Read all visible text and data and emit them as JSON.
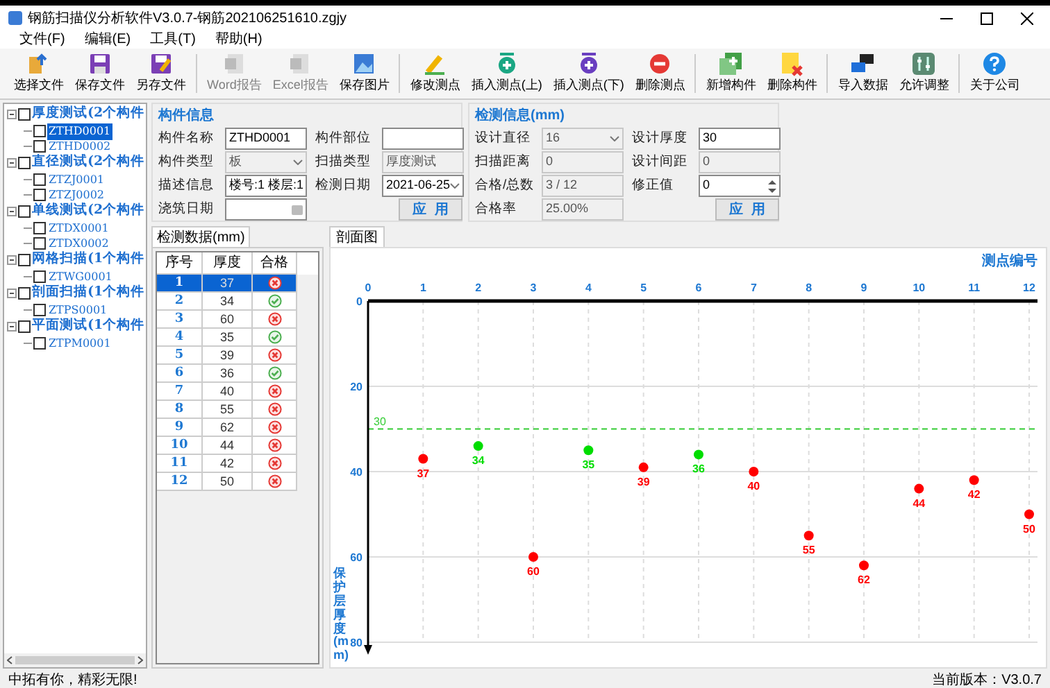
{
  "window": {
    "title": "钢筋扫描仪分析软件V3.0.7-钢筋202106251610.zgjy"
  },
  "menu": [
    "文件(F)",
    "编辑(E)",
    "工具(T)",
    "帮助(H)"
  ],
  "toolbar": [
    [
      {
        "label": "选择文件",
        "disabled": false
      },
      {
        "label": "保存文件",
        "disabled": false
      },
      {
        "label": "另存文件",
        "disabled": false
      }
    ],
    [
      {
        "label": "Word报告",
        "disabled": true
      },
      {
        "label": "Excel报告",
        "disabled": true
      },
      {
        "label": "保存图片",
        "disabled": false
      }
    ],
    [
      {
        "label": "修改测点",
        "disabled": false
      },
      {
        "label": "插入测点(上)",
        "disabled": false
      },
      {
        "label": "插入测点(下)",
        "disabled": false
      },
      {
        "label": "删除测点",
        "disabled": false
      }
    ],
    [
      {
        "label": "新增构件",
        "disabled": false
      },
      {
        "label": "删除构件",
        "disabled": false
      }
    ],
    [
      {
        "label": "导入数据",
        "disabled": false
      },
      {
        "label": "允许调整",
        "disabled": false
      }
    ],
    [
      {
        "label": "关于公司",
        "disabled": false
      }
    ]
  ],
  "tree": [
    {
      "label": "厚度测试(2个构件",
      "checked": false,
      "expanded": true,
      "children": [
        {
          "label": "ZTHD0001",
          "checked": false,
          "selected": true
        },
        {
          "label": "ZTHD0002",
          "checked": false,
          "selected": false
        }
      ]
    },
    {
      "label": "直径测试(2个构件",
      "checked": false,
      "expanded": true,
      "children": [
        {
          "label": "ZTZJ0001",
          "checked": false,
          "selected": false
        },
        {
          "label": "ZTZJ0002",
          "checked": false,
          "selected": false
        }
      ]
    },
    {
      "label": "单线测试(2个构件",
      "checked": false,
      "expanded": true,
      "children": [
        {
          "label": "ZTDX0001",
          "checked": false,
          "selected": false
        },
        {
          "label": "ZTDX0002",
          "checked": false,
          "selected": false
        }
      ]
    },
    {
      "label": "网格扫描(1个构件",
      "checked": false,
      "expanded": true,
      "children": [
        {
          "label": "ZTWG0001",
          "checked": false,
          "selected": false
        }
      ]
    },
    {
      "label": "剖面扫描(1个构件",
      "checked": false,
      "expanded": true,
      "children": [
        {
          "label": "ZTPS0001",
          "checked": false,
          "selected": false
        }
      ]
    },
    {
      "label": "平面测试(1个构件",
      "checked": false,
      "expanded": true,
      "children": [
        {
          "label": "ZTPM0001",
          "checked": false,
          "selected": false
        }
      ]
    }
  ],
  "component_info": {
    "title": "构件信息",
    "fields": [
      {
        "label": "构件名称",
        "value": "ZTHD0001",
        "kind": "text",
        "disabled": false
      },
      {
        "label": "构件部位",
        "kind": "text",
        "disabled": false
      },
      {
        "label": "构件类型",
        "value": "板",
        "kind": "select",
        "disabled": true
      },
      {
        "label": "扫描类型",
        "value": "厚度测试",
        "kind": "text",
        "disabled": true
      },
      {
        "label": "描述信息",
        "value": "楼号:1 楼层:1",
        "kind": "text",
        "disabled": false
      },
      {
        "label": "检测日期",
        "value": "2021-06-25",
        "kind": "select",
        "disabled": false
      },
      {
        "label": "浇筑日期",
        "kind": "date",
        "disabled": false
      }
    ],
    "apply": "应  用"
  },
  "detect_info": {
    "title": "检测信息(mm)",
    "fields": [
      {
        "label": "设计直径",
        "value": "16",
        "kind": "select",
        "disabled": true
      },
      {
        "label": "设计厚度",
        "value": "30",
        "kind": "text",
        "disabled": false
      },
      {
        "label": "扫描距离",
        "value": "0",
        "kind": "text",
        "disabled": true
      },
      {
        "label": "设计间距",
        "value": "0",
        "kind": "text",
        "disabled": true
      },
      {
        "label": "合格/总数",
        "value": "3 / 12",
        "kind": "text",
        "disabled": true
      },
      {
        "label": "修正值",
        "value": "0",
        "kind": "spin",
        "disabled": false
      },
      {
        "label": "合格率",
        "value": "25.00%",
        "kind": "text",
        "disabled": true
      }
    ],
    "apply": "应  用"
  },
  "data_tab": {
    "label": "检测数据(mm)",
    "columns": [
      "序号",
      "厚度",
      "合格"
    ],
    "rows": [
      {
        "no": "1",
        "value": "37",
        "pass": false,
        "selected": true
      },
      {
        "no": "2",
        "value": "34",
        "pass": true,
        "selected": false
      },
      {
        "no": "3",
        "value": "60",
        "pass": false,
        "selected": false
      },
      {
        "no": "4",
        "value": "35",
        "pass": true,
        "selected": false
      },
      {
        "no": "5",
        "value": "39",
        "pass": false,
        "selected": false
      },
      {
        "no": "6",
        "value": "36",
        "pass": true,
        "selected": false
      },
      {
        "no": "7",
        "value": "40",
        "pass": false,
        "selected": false
      },
      {
        "no": "8",
        "value": "55",
        "pass": false,
        "selected": false
      },
      {
        "no": "9",
        "value": "62",
        "pass": false,
        "selected": false
      },
      {
        "no": "10",
        "value": "44",
        "pass": false,
        "selected": false
      },
      {
        "no": "11",
        "value": "42",
        "pass": false,
        "selected": false
      },
      {
        "no": "12",
        "value": "50",
        "pass": false,
        "selected": false
      }
    ]
  },
  "chart_tab": {
    "label": "剖面图",
    "chart_data": {
      "type": "scatter",
      "xlabel": "测点编号",
      "ylabel": "保护层厚度(mm)",
      "x": [
        1,
        2,
        3,
        4,
        5,
        6,
        7,
        8,
        9,
        10,
        11,
        12
      ],
      "series": [
        {
          "color": "#ff0000",
          "values": [
            37,
            null,
            60,
            null,
            39,
            null,
            40,
            55,
            62,
            44,
            42,
            50
          ]
        },
        {
          "color": "#00dd00",
          "values": [
            null,
            34,
            null,
            35,
            null,
            36,
            null,
            null,
            null,
            null,
            null,
            null
          ]
        }
      ],
      "xlim": [
        0,
        12
      ],
      "ylim": [
        80,
        0
      ],
      "xticks": [
        0,
        1,
        2,
        3,
        4,
        5,
        6,
        7,
        8,
        9,
        10,
        11,
        12
      ],
      "yticks": [
        0,
        20,
        40,
        60,
        80
      ],
      "data_labels": true,
      "grid": true,
      "ref_lines": [
        {
          "axis": "y",
          "value": 30,
          "label": "30",
          "color": "#33cc33"
        }
      ]
    }
  },
  "status_bar": {
    "left": "中拓有你，精彩无限!",
    "right": "当前版本：V3.0.7"
  }
}
